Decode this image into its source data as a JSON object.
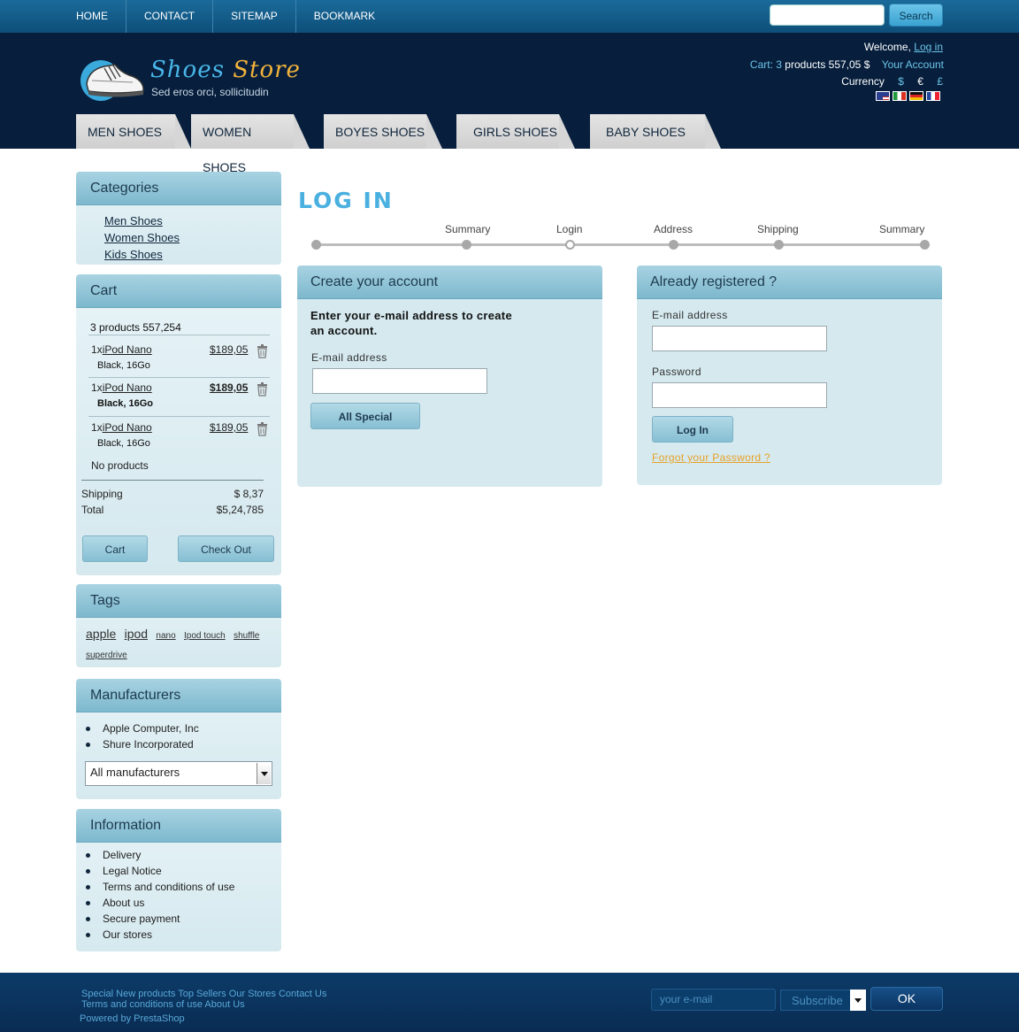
{
  "topnav": [
    "HOME",
    "CONTACT",
    "SITEMAP",
    "BOOKMARK"
  ],
  "search": {
    "button_label": "Search",
    "placeholder": ""
  },
  "logo": {
    "word1": "Shoes",
    "word2": "Store",
    "tagline": "Sed eros orci, sollicitudin"
  },
  "account": {
    "welcome": "Welcome,",
    "login_link": "Log in",
    "cart_label": "Cart:",
    "cart_count": "3",
    "cart_text": "products 557,05 $",
    "your_account": "Your Account",
    "currency_label": "Currency",
    "currencies": [
      "$",
      "€",
      "£"
    ]
  },
  "flags": [
    "us-flag-icon",
    "italy-flag-icon",
    "germany-flag-icon",
    "france-flag-icon"
  ],
  "cattabs": [
    "MEN SHOES",
    "WOMEN SHOES",
    "BOYES SHOES",
    "GIRLS SHOES",
    "BABY SHOES"
  ],
  "categories": {
    "title": "Categories",
    "items": [
      "Men Shoes",
      "Women Shoes",
      "Kids Shoes"
    ]
  },
  "cart": {
    "title": "Cart",
    "summary": "3 products 557,254",
    "items": [
      {
        "qty": "1x",
        "name": "iPod Nano",
        "price": "$189,05",
        "attr": "Black, 16Go"
      },
      {
        "qty": "1x",
        "name": "iPod Nano",
        "price": "$189,05",
        "attr": "Black, 16Go"
      },
      {
        "qty": "1x",
        "name": "iPod Nano",
        "price": "$189,05",
        "attr": "Black, 16Go"
      }
    ],
    "no_products": "No products",
    "shipping_label": "Shipping",
    "shipping_value": "$ 8,37",
    "total_label": "Total",
    "total_value": "$5,24,785",
    "cart_button": "Cart",
    "checkout_button": "Check Out"
  },
  "tags": {
    "title": "Tags",
    "items": [
      "apple",
      "ipod",
      "nano",
      "Ipod touch",
      "shuffle",
      "superdrive"
    ]
  },
  "manufacturers": {
    "title": "Manufacturers",
    "items": [
      "Apple Computer, Inc",
      "Shure Incorporated"
    ],
    "select_value": "All manufacturers"
  },
  "information": {
    "title": "Information",
    "items": [
      "Delivery",
      "Legal Notice",
      "Terms and conditions of use",
      "About us",
      "Secure payment",
      "Our stores"
    ]
  },
  "main": {
    "title": "LOG IN",
    "steps": [
      "Summary",
      "Login",
      "Address",
      "Shipping",
      "Summary"
    ]
  },
  "create_account": {
    "title": "Create your account",
    "text": "Enter your e-mail address to create an account.",
    "email_label": "E-mail address",
    "button": "All Special"
  },
  "registered": {
    "title": "Already registered ?",
    "email_label": "E-mail address",
    "password_label": "Password",
    "button": "Log In",
    "forgot": "Forgot your Password ?"
  },
  "footer": {
    "links_line1": "Special New products Top Sellers Our Stores Contact Us",
    "links_line2": "Terms and conditions of use   About  Us",
    "powered": "Powered by PrestaShop",
    "email_placeholder": "your e-mail",
    "subscribe": "Subscribe",
    "ok": "OK"
  }
}
